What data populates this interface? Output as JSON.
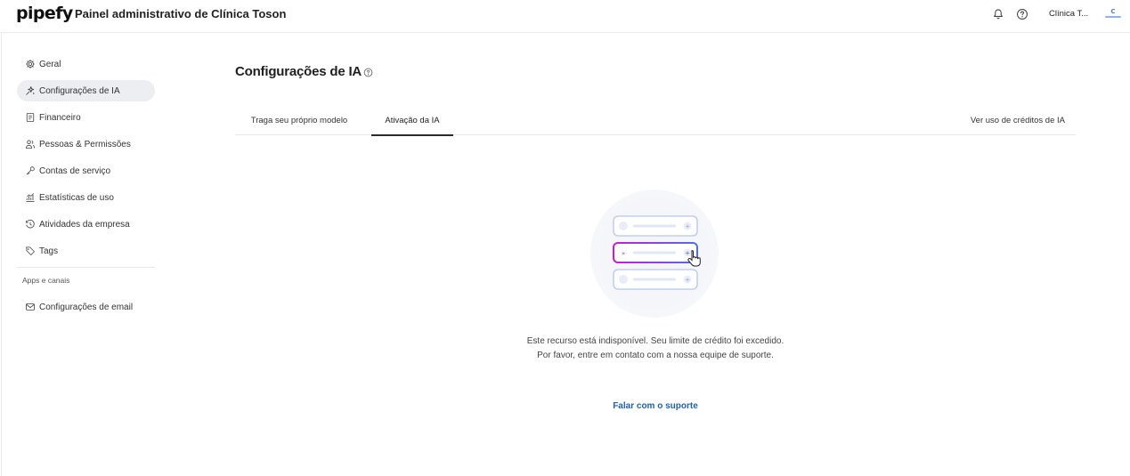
{
  "header": {
    "logo": "pipefy",
    "title": "Painel administrativo de Clínica Toson",
    "company": "Clínica T...",
    "icons": [
      "bell-icon",
      "help-icon"
    ]
  },
  "sidebar": {
    "items": [
      {
        "label": "Geral",
        "icon": "gear-icon"
      },
      {
        "label": "Configurações de IA",
        "icon": "sparkle-icon",
        "active": true
      },
      {
        "label": "Financeiro",
        "icon": "receipt-icon"
      },
      {
        "label": "Pessoas & Permissões",
        "icon": "people-icon"
      },
      {
        "label": "Contas de serviço",
        "icon": "key-icon"
      },
      {
        "label": "Estatísticas de uso",
        "icon": "chart-icon"
      },
      {
        "label": "Atividades da empresa",
        "icon": "history-icon"
      },
      {
        "label": "Tags",
        "icon": "tag-icon"
      }
    ],
    "section_label": "Apps e canais",
    "section_items": [
      {
        "label": "Configurações de email",
        "icon": "mail-icon"
      }
    ]
  },
  "main": {
    "title": "Configurações de IA",
    "tabs": [
      {
        "label": "Traga seu próprio modelo"
      },
      {
        "label": "Ativação da IA",
        "active": true
      }
    ],
    "credits_link": "Ver uso de créditos de IA",
    "empty_state": {
      "message": "Este recurso está indisponível. Seu limite de crédito foi excedido. Por favor, entre em contato com a nossa equipe de suporte.",
      "link": "Falar com o suporte"
    }
  },
  "colors": {
    "accent_link": "#1d5fc4",
    "active_nav_bg": "#eceef1",
    "illustration_gradient": [
      "#c21fd1",
      "#4d6ee8"
    ]
  }
}
